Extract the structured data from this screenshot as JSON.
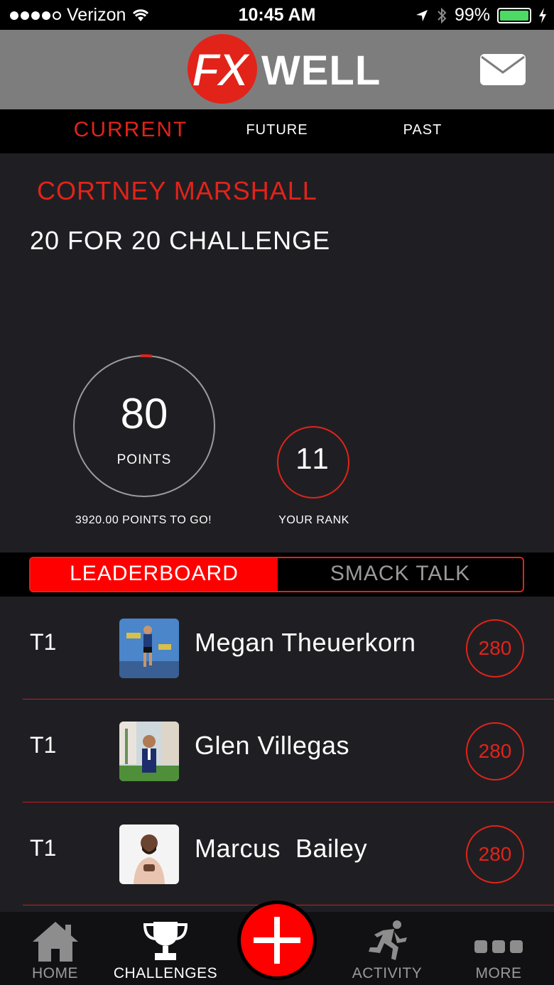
{
  "status_bar": {
    "carrier": "Verizon",
    "time": "10:45 AM",
    "battery": "99%",
    "battery_level": 0.99
  },
  "header": {
    "logo_fx": "FX",
    "logo_well": "WELL"
  },
  "tabs": [
    {
      "label": "CURRENT",
      "active": true
    },
    {
      "label": "FUTURE",
      "active": false
    },
    {
      "label": "PAST",
      "active": false
    }
  ],
  "challenge": {
    "owner": "CORTNEY MARSHALL",
    "name": "20 FOR 20 CHALLENGE",
    "points": "80",
    "points_label": "POINTS",
    "points_to_go": "3920.00 POINTS TO GO!",
    "rank": "11",
    "rank_label": "YOUR RANK"
  },
  "segments": {
    "leaderboard": "LEADERBOARD",
    "smack_talk": "SMACK TALK"
  },
  "leaderboard": [
    {
      "rank": "T1",
      "name": "Megan Theuerkorn",
      "score": "280"
    },
    {
      "rank": "T1",
      "name": "Glen Villegas",
      "score": "280"
    },
    {
      "rank": "T1",
      "name": "Marcus  Bailey",
      "score": "280"
    }
  ],
  "bottom_nav": {
    "home": "HOME",
    "challenges": "CHALLENGES",
    "activity": "ACTIVITY",
    "more": "MORE"
  },
  "colors": {
    "accent": "#e2231a",
    "background": "#1f1f23",
    "header_gray": "#7d7d7d"
  }
}
